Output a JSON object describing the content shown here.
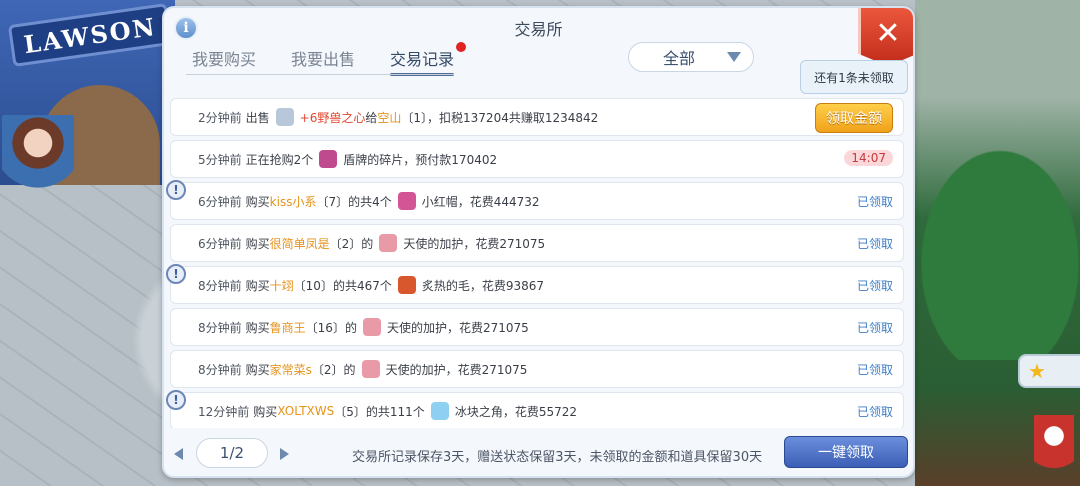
{
  "background": {
    "store_sign": "LAWSON"
  },
  "panel": {
    "title": "交易所"
  },
  "tabs": [
    {
      "label": "我要购买",
      "active": false
    },
    {
      "label": "我要出售",
      "active": false
    },
    {
      "label": "交易记录",
      "active": true
    }
  ],
  "filter": {
    "selected": "全部"
  },
  "unclaimed_tip": "还有1条未领取",
  "rows": [
    {
      "time": "2分钟前",
      "action": "出售",
      "item": "+6野兽之心",
      "mid": "给",
      "buyer": "空山",
      "detail": "〔1〕，扣税137204共赚取1234842",
      "button": "领取金额",
      "icon_color": "#b9c7da"
    },
    {
      "time": "5分钟前",
      "action": "正在抢购2个",
      "item": "盾牌的碎片",
      "detail": "，预付款170402",
      "timer": "14:07",
      "icon_color": "#c04a8e"
    },
    {
      "time": "6分钟前",
      "action": "购买",
      "seller": "kiss小系",
      "detail1": "〔7〕的共4个",
      "item": "小红帽",
      "detail2": "，花费444732",
      "status": "已领取",
      "icon_color": "#d45596"
    },
    {
      "time": "6分钟前",
      "action": "购买",
      "seller": "很简单凤是",
      "detail1": "〔2〕的",
      "item": "天使的加护",
      "detail2": "，花费271075",
      "status": "已领取",
      "icon_color": "#e89aa7"
    },
    {
      "time": "8分钟前",
      "action": "购买",
      "seller": "十翊",
      "detail1": "〔10〕的共467个",
      "item": "炙热的毛",
      "detail2": "，花费93867",
      "status": "已领取",
      "icon_color": "#d9572c"
    },
    {
      "time": "8分钟前",
      "action": "购买",
      "seller": "鲁商王",
      "detail1": "〔16〕的",
      "item": "天使的加护",
      "detail2": "，花费271075",
      "status": "已领取",
      "icon_color": "#e89aa7"
    },
    {
      "time": "8分钟前",
      "action": "购买",
      "seller": "家常菜s",
      "detail1": "〔2〕的",
      "item": "天使的加护",
      "detail2": "，花费271075",
      "status": "已领取",
      "icon_color": "#e89aa7"
    },
    {
      "time": "12分钟前",
      "action": "购买",
      "seller": "XOLTXWS",
      "detail1": "〔5〕的共111个",
      "item": "冰块之角",
      "detail2": "，花费55722",
      "status": "已领取",
      "icon_color": "#8fd0f2"
    }
  ],
  "pagination": {
    "page": "1/2"
  },
  "footer": {
    "note": "交易所记录保存3天，赠送状态保留3天，未领取的金额和道具保留30天",
    "claim_all": "一键领取"
  },
  "alert_symbol": "!",
  "close_symbol": "✕",
  "info_symbol": "i"
}
